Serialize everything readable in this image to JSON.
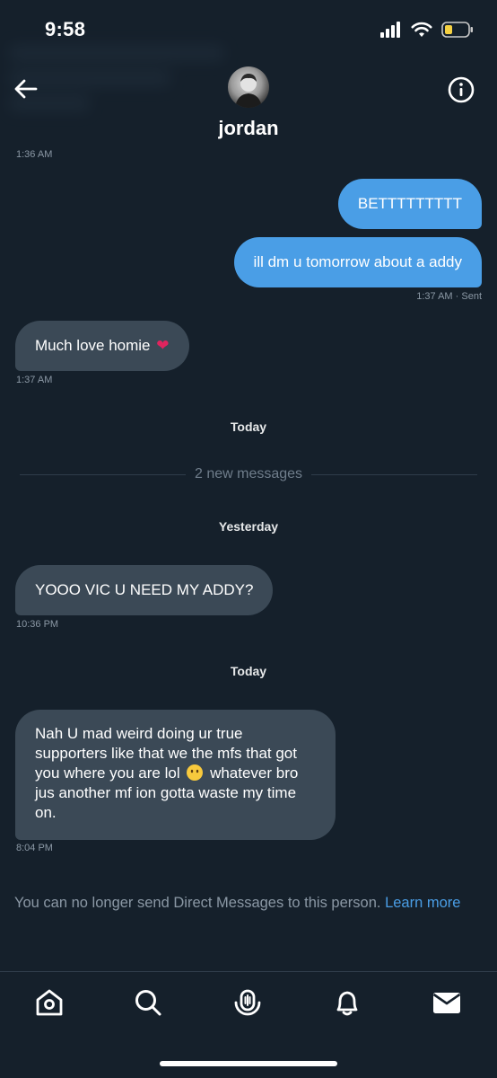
{
  "status": {
    "time": "9:58"
  },
  "header": {
    "name": "jordan"
  },
  "messages": [
    {
      "ts": "1:36 AM"
    },
    {
      "text": "BETTTTTTTTT"
    },
    {
      "text": "ill dm u tomorrow about a addy",
      "meta": "1:37 AM · Sent"
    },
    {
      "text": "Much love homie",
      "emoji": "❤",
      "ts": "1:37 AM"
    },
    {
      "text": "YOOO VIC U NEED MY ADDY?",
      "ts": "10:36 PM"
    },
    {
      "lines": [
        "Nah U mad weird doing ur true",
        "supporters like that we the mfs that got",
        "you where you are lol",
        "whatever bro",
        "jus another mf ion gotta waste my time",
        "on."
      ],
      "ts": "8:04 PM"
    }
  ],
  "labels": {
    "today1": "Today",
    "new_messages": "2 new messages",
    "yesterday": "Yesterday",
    "today2": "Today"
  },
  "notice": {
    "text": "You can no longer send Direct Messages to this person.",
    "link": "Learn more"
  },
  "colors": {
    "background": "#15202b",
    "outgoing": "#4a9ee6",
    "incoming": "#3b4956",
    "link": "#4a9ee6"
  },
  "tabs": [
    {
      "icon": "home-icon"
    },
    {
      "icon": "search-icon"
    },
    {
      "icon": "spaces-icon"
    },
    {
      "icon": "notifications-icon"
    },
    {
      "icon": "messages-icon"
    }
  ]
}
